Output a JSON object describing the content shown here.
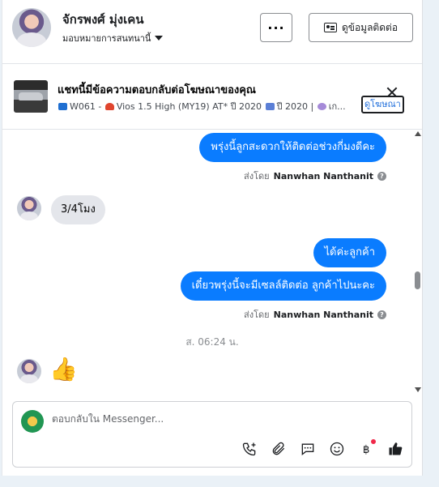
{
  "header": {
    "name": "จักรพงศ์ มุ่งเคน",
    "assignment": "มอบหมายการสนทนานี้",
    "more_label": "···",
    "contact_label": "ดูข้อมูลติดต่อ"
  },
  "ad": {
    "title": "แชทนี้มีข้อความตอบกลับต่อโฆษณาของคุณ",
    "desc_parts": [
      "W061 -",
      "Vios 1.5 High (MY19) AT* ปี 2020",
      "ปี 2020 |",
      "เก..."
    ],
    "view_label": "ดูโฆษณา"
  },
  "messages": {
    "m1": "พรุ่งนี้ลูกสะดวกให้ติดต่อช่วงกี่มงดีคะ",
    "sent_by_prefix": "ส่งโดย",
    "sender": "Nanwhan Nanthanit",
    "m2": "3/4โมง",
    "m3": "ได้ค่ะลูกค้า",
    "m4": "เดี๋ยวพรุ่งนี้จะมีเซลล์ติดต่อ ลูกค้าไปนะคะ",
    "timestamp": "ส. 06:24 น.",
    "m5": "👍"
  },
  "composer": {
    "placeholder": "ตอบกลับใน Messenger..."
  },
  "colors": {
    "accent": "#0a7cff",
    "incoming": "#e4e6eb",
    "link": "#216fdb"
  }
}
